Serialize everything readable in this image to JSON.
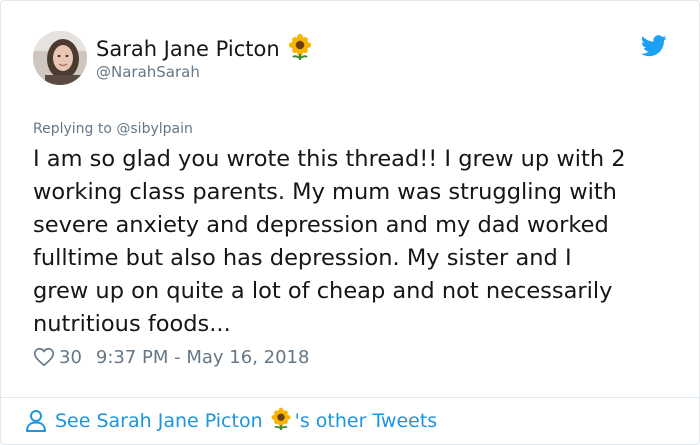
{
  "author": {
    "display_name": "Sarah Jane Picton",
    "handle": "@NarahSarah",
    "name_emoji_icon": "sunflower-icon"
  },
  "platform_icon": "twitter-bird-icon",
  "reply": {
    "prefix": "Replying to",
    "to_handle": "@sibylpain"
  },
  "tweet": {
    "lines": [
      "I am so glad you wrote this thread!! I grew up with 2",
      "working class parents. My mum was struggling with",
      "severe anxiety and depression and my dad worked",
      "fulltime but also has depression. My sister and I",
      "grew up on quite a lot of cheap and not necessarily",
      "nutritious foods..."
    ],
    "like_count": "30",
    "timestamp": "9:37 PM - May 16, 2018"
  },
  "footer": {
    "prefix": "See Sarah Jane Picton",
    "suffix": "'s other Tweets",
    "icon": "person-icon"
  },
  "colors": {
    "link_blue": "#1b95e0",
    "secondary_text": "#657786",
    "primary_text": "#14171a",
    "twitter_blue": "#1da1f2"
  }
}
